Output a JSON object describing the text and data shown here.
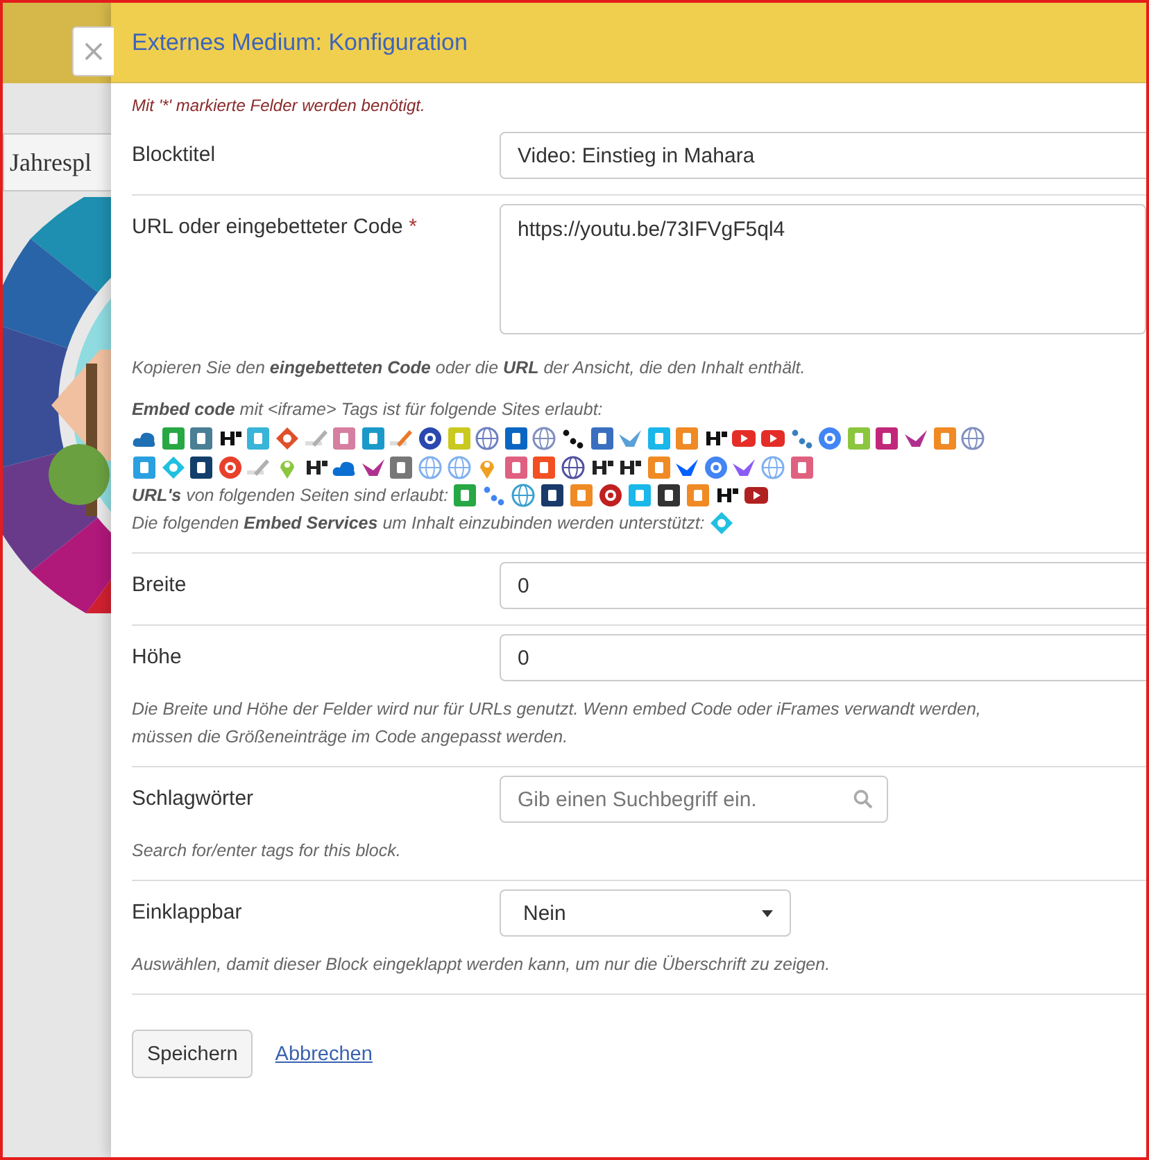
{
  "background": {
    "tab_label": "Jahrespl"
  },
  "dialog": {
    "close": "×",
    "title": "Externes Medium: Konfiguration",
    "required_note": "Mit '*' markierte Felder werden benötigt."
  },
  "fields": [
    {
      "kind": "text",
      "label": "Blocktitel",
      "value": "Video: Einstieg in Mahara"
    },
    {
      "kind": "textarea",
      "label": "URL oder eingebetteter Code",
      "required_mark": "*",
      "value": "https://youtu.be/73IFVgF5ql4",
      "help": "Kopieren Sie den **eingebetteten Code** oder die **URL** der Ansicht, die den Inhalt enthält.",
      "embed_sites": {
        "label": "**Embed code** mit <iframe> Tags ist für folgende Sites erlaubt:",
        "icons": [
          {
            "kind": "cloud",
            "color": "#1f6fb5"
          },
          {
            "kind": "tile",
            "color": "#27a844"
          },
          {
            "kind": "tile",
            "color": "#4a7f96"
          },
          {
            "kind": "mark",
            "color": "#111111"
          },
          {
            "kind": "tile",
            "color": "#38b5d8"
          },
          {
            "kind": "diamond",
            "color": "#e0502a"
          },
          {
            "kind": "pencil",
            "color": "#b0b0b0"
          },
          {
            "kind": "tile",
            "color": "#d77fa0"
          },
          {
            "kind": "tile",
            "color": "#1b9ac9"
          },
          {
            "kind": "pencil",
            "color": "#e87a2a"
          },
          {
            "kind": "circle",
            "color": "#2a48b0"
          },
          {
            "kind": "tile",
            "color": "#c9c920"
          },
          {
            "kind": "globe",
            "color": "#6d7fc0"
          },
          {
            "kind": "tile",
            "color": "#0a66c2"
          },
          {
            "kind": "globe",
            "color": "#7f8fbf"
          },
          {
            "kind": "dots",
            "color": "#111111"
          },
          {
            "kind": "tile",
            "color": "#3a6fc0"
          },
          {
            "kind": "bird",
            "color": "#5aa0d8"
          },
          {
            "kind": "tile",
            "color": "#1ab7ea"
          },
          {
            "kind": "tile",
            "color": "#f08a24"
          },
          {
            "kind": "mark",
            "color": "#111111"
          },
          {
            "kind": "play",
            "color": "#e52d27"
          },
          {
            "kind": "play",
            "color": "#e52d27"
          },
          {
            "kind": "dots",
            "color": "#3a80c0"
          },
          {
            "kind": "circle",
            "color": "#4285f4"
          },
          {
            "kind": "tile",
            "color": "#8cc63f"
          },
          {
            "kind": "tile",
            "color": "#c2287a"
          },
          {
            "kind": "bird",
            "color": "#b03090"
          },
          {
            "kind": "tile",
            "color": "#f08a24"
          },
          {
            "kind": "globe",
            "color": "#7f8fbf"
          },
          {
            "kind": "tile",
            "color": "#2aa0e0"
          },
          {
            "kind": "diamond",
            "color": "#20c0e0"
          },
          {
            "kind": "tile",
            "color": "#123e6b"
          },
          {
            "kind": "circle",
            "color": "#e8402a"
          },
          {
            "kind": "pencil",
            "color": "#b0b0b0"
          },
          {
            "kind": "pin",
            "color": "#8cc63f"
          },
          {
            "kind": "mark",
            "color": "#222222"
          },
          {
            "kind": "cloud",
            "color": "#0a6fd0"
          },
          {
            "kind": "bird",
            "color": "#b03090"
          },
          {
            "kind": "tile",
            "color": "#777777"
          },
          {
            "kind": "globe",
            "color": "#7fb0f0"
          },
          {
            "kind": "globe",
            "color": "#7fb0f0"
          },
          {
            "kind": "pin",
            "color": "#f0a020"
          },
          {
            "kind": "tile",
            "color": "#e06080"
          },
          {
            "kind": "tile",
            "color": "#f25022"
          },
          {
            "kind": "globe",
            "color": "#5050a0"
          },
          {
            "kind": "mark",
            "color": "#222222"
          },
          {
            "kind": "mark",
            "color": "#222222"
          },
          {
            "kind": "tile",
            "color": "#f08a24"
          },
          {
            "kind": "bird",
            "color": "#0061fe"
          },
          {
            "kind": "circle",
            "color": "#4285f4"
          },
          {
            "kind": "bird",
            "color": "#8a5cf5"
          },
          {
            "kind": "globe",
            "color": "#7fb0f0"
          },
          {
            "kind": "tile",
            "color": "#e06080"
          }
        ]
      },
      "url_sites": {
        "label": "**URL's** von folgenden Seiten sind erlaubt:",
        "icons": [
          {
            "kind": "tile",
            "color": "#27a844"
          },
          {
            "kind": "dots",
            "color": "#4285f4"
          },
          {
            "kind": "globe",
            "color": "#3aa0d0"
          },
          {
            "kind": "tile",
            "color": "#1a3a6a"
          },
          {
            "kind": "tile",
            "color": "#f08a24"
          },
          {
            "kind": "circle",
            "color": "#c02020"
          },
          {
            "kind": "tile",
            "color": "#1ab7ea"
          },
          {
            "kind": "tile",
            "color": "#333333"
          },
          {
            "kind": "tile",
            "color": "#f08a24"
          },
          {
            "kind": "mark",
            "color": "#111111"
          },
          {
            "kind": "play",
            "color": "#b02020"
          }
        ]
      },
      "embed_services": {
        "label": "Die folgenden **Embed Services** um Inhalt einzubinden werden unterstützt:",
        "icons": [
          {
            "kind": "diamond",
            "color": "#20c0e0"
          }
        ]
      }
    },
    {
      "kind": "text",
      "label": "Breite",
      "value": "0"
    },
    {
      "kind": "text",
      "label": "Höhe",
      "value": "0",
      "help": "Die Breite und Höhe der Felder wird nur für URLs genutzt. Wenn embed Code oder iFrames verwandt werden, müssen die Größeneinträge im Code angepasst werden."
    },
    {
      "kind": "tags",
      "label": "Schlagwörter",
      "placeholder": "Gib einen Suchbegriff ein.",
      "help": "Search for/enter tags for this block."
    },
    {
      "kind": "select",
      "label": "Einklappbar",
      "value": "Nein",
      "help": "Auswählen, damit dieser Block eingeklappt werden kann, um nur die Überschrift zu zeigen."
    }
  ],
  "actions": {
    "save": "Speichern",
    "cancel": "Abbrechen"
  }
}
